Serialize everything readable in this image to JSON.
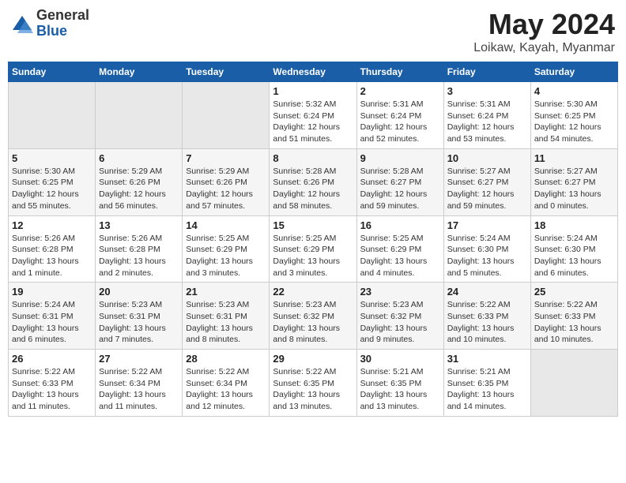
{
  "header": {
    "logo_line1": "General",
    "logo_line2": "Blue",
    "month": "May 2024",
    "location": "Loikaw, Kayah, Myanmar"
  },
  "weekdays": [
    "Sunday",
    "Monday",
    "Tuesday",
    "Wednesday",
    "Thursday",
    "Friday",
    "Saturday"
  ],
  "weeks": [
    [
      {
        "day": "",
        "info": ""
      },
      {
        "day": "",
        "info": ""
      },
      {
        "day": "",
        "info": ""
      },
      {
        "day": "1",
        "info": "Sunrise: 5:32 AM\nSunset: 6:24 PM\nDaylight: 12 hours\nand 51 minutes."
      },
      {
        "day": "2",
        "info": "Sunrise: 5:31 AM\nSunset: 6:24 PM\nDaylight: 12 hours\nand 52 minutes."
      },
      {
        "day": "3",
        "info": "Sunrise: 5:31 AM\nSunset: 6:24 PM\nDaylight: 12 hours\nand 53 minutes."
      },
      {
        "day": "4",
        "info": "Sunrise: 5:30 AM\nSunset: 6:25 PM\nDaylight: 12 hours\nand 54 minutes."
      }
    ],
    [
      {
        "day": "5",
        "info": "Sunrise: 5:30 AM\nSunset: 6:25 PM\nDaylight: 12 hours\nand 55 minutes."
      },
      {
        "day": "6",
        "info": "Sunrise: 5:29 AM\nSunset: 6:26 PM\nDaylight: 12 hours\nand 56 minutes."
      },
      {
        "day": "7",
        "info": "Sunrise: 5:29 AM\nSunset: 6:26 PM\nDaylight: 12 hours\nand 57 minutes."
      },
      {
        "day": "8",
        "info": "Sunrise: 5:28 AM\nSunset: 6:26 PM\nDaylight: 12 hours\nand 58 minutes."
      },
      {
        "day": "9",
        "info": "Sunrise: 5:28 AM\nSunset: 6:27 PM\nDaylight: 12 hours\nand 59 minutes."
      },
      {
        "day": "10",
        "info": "Sunrise: 5:27 AM\nSunset: 6:27 PM\nDaylight: 12 hours\nand 59 minutes."
      },
      {
        "day": "11",
        "info": "Sunrise: 5:27 AM\nSunset: 6:27 PM\nDaylight: 13 hours\nand 0 minutes."
      }
    ],
    [
      {
        "day": "12",
        "info": "Sunrise: 5:26 AM\nSunset: 6:28 PM\nDaylight: 13 hours\nand 1 minute."
      },
      {
        "day": "13",
        "info": "Sunrise: 5:26 AM\nSunset: 6:28 PM\nDaylight: 13 hours\nand 2 minutes."
      },
      {
        "day": "14",
        "info": "Sunrise: 5:25 AM\nSunset: 6:29 PM\nDaylight: 13 hours\nand 3 minutes."
      },
      {
        "day": "15",
        "info": "Sunrise: 5:25 AM\nSunset: 6:29 PM\nDaylight: 13 hours\nand 3 minutes."
      },
      {
        "day": "16",
        "info": "Sunrise: 5:25 AM\nSunset: 6:29 PM\nDaylight: 13 hours\nand 4 minutes."
      },
      {
        "day": "17",
        "info": "Sunrise: 5:24 AM\nSunset: 6:30 PM\nDaylight: 13 hours\nand 5 minutes."
      },
      {
        "day": "18",
        "info": "Sunrise: 5:24 AM\nSunset: 6:30 PM\nDaylight: 13 hours\nand 6 minutes."
      }
    ],
    [
      {
        "day": "19",
        "info": "Sunrise: 5:24 AM\nSunset: 6:31 PM\nDaylight: 13 hours\nand 6 minutes."
      },
      {
        "day": "20",
        "info": "Sunrise: 5:23 AM\nSunset: 6:31 PM\nDaylight: 13 hours\nand 7 minutes."
      },
      {
        "day": "21",
        "info": "Sunrise: 5:23 AM\nSunset: 6:31 PM\nDaylight: 13 hours\nand 8 minutes."
      },
      {
        "day": "22",
        "info": "Sunrise: 5:23 AM\nSunset: 6:32 PM\nDaylight: 13 hours\nand 8 minutes."
      },
      {
        "day": "23",
        "info": "Sunrise: 5:23 AM\nSunset: 6:32 PM\nDaylight: 13 hours\nand 9 minutes."
      },
      {
        "day": "24",
        "info": "Sunrise: 5:22 AM\nSunset: 6:33 PM\nDaylight: 13 hours\nand 10 minutes."
      },
      {
        "day": "25",
        "info": "Sunrise: 5:22 AM\nSunset: 6:33 PM\nDaylight: 13 hours\nand 10 minutes."
      }
    ],
    [
      {
        "day": "26",
        "info": "Sunrise: 5:22 AM\nSunset: 6:33 PM\nDaylight: 13 hours\nand 11 minutes."
      },
      {
        "day": "27",
        "info": "Sunrise: 5:22 AM\nSunset: 6:34 PM\nDaylight: 13 hours\nand 11 minutes."
      },
      {
        "day": "28",
        "info": "Sunrise: 5:22 AM\nSunset: 6:34 PM\nDaylight: 13 hours\nand 12 minutes."
      },
      {
        "day": "29",
        "info": "Sunrise: 5:22 AM\nSunset: 6:35 PM\nDaylight: 13 hours\nand 13 minutes."
      },
      {
        "day": "30",
        "info": "Sunrise: 5:21 AM\nSunset: 6:35 PM\nDaylight: 13 hours\nand 13 minutes."
      },
      {
        "day": "31",
        "info": "Sunrise: 5:21 AM\nSunset: 6:35 PM\nDaylight: 13 hours\nand 14 minutes."
      },
      {
        "day": "",
        "info": ""
      }
    ]
  ]
}
